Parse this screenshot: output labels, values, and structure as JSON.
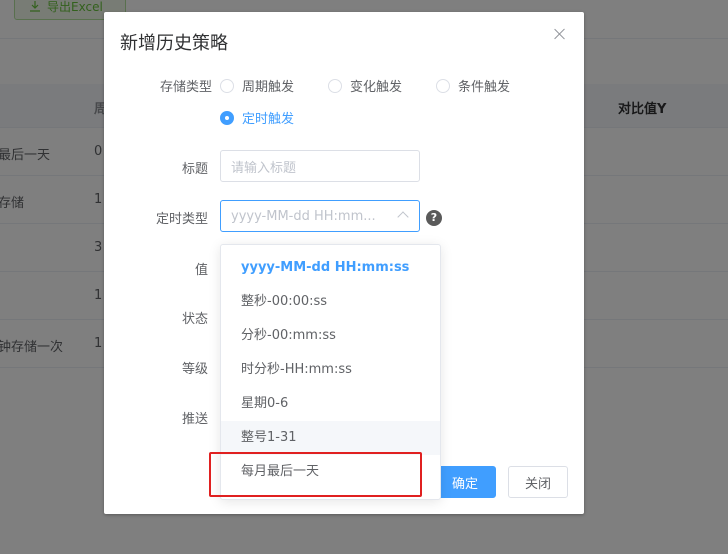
{
  "background": {
    "export_button": "导出Excel",
    "headers": {
      "col2": "周",
      "col_right": "对比值Y"
    },
    "rows": [
      {
        "c1": "最后一天",
        "c2": "0"
      },
      {
        "c1": "存储",
        "c2": "1"
      },
      {
        "c1": "",
        "c2": "3"
      },
      {
        "c1": "",
        "c2": "1"
      },
      {
        "c1": "钟存储一次",
        "c2": "1"
      }
    ]
  },
  "dialog": {
    "title": "新增历史策略",
    "form": {
      "storage_type_label": "存储类型",
      "storage_types": [
        {
          "label": "周期触发",
          "checked": false
        },
        {
          "label": "变化触发",
          "checked": false
        },
        {
          "label": "条件触发",
          "checked": false
        },
        {
          "label": "定时触发",
          "checked": true
        }
      ],
      "title_label": "标题",
      "title_placeholder": "请输入标题",
      "timer_type_label": "定时类型",
      "timer_type_value": "yyyy-MM-dd HH:mm...",
      "value_label": "值",
      "status_label": "状态",
      "level_label": "等级",
      "push_label": "推送"
    },
    "dropdown_options": [
      {
        "label": "yyyy-MM-dd HH:mm:ss",
        "selected": true
      },
      {
        "label": "整秒-00:00:ss"
      },
      {
        "label": "分秒-00:mm:ss"
      },
      {
        "label": "时分秒-HH:mm:ss"
      },
      {
        "label": "星期0-6"
      },
      {
        "label": "整号1-31",
        "hovered": true
      },
      {
        "label": "每月最后一天"
      }
    ],
    "buttons": {
      "confirm": "确定",
      "close": "关闭"
    },
    "help_icon": "?"
  },
  "colors": {
    "primary": "#409eff",
    "highlight": "#e02020",
    "mask": "rgba(0,0,0,0.5)"
  }
}
